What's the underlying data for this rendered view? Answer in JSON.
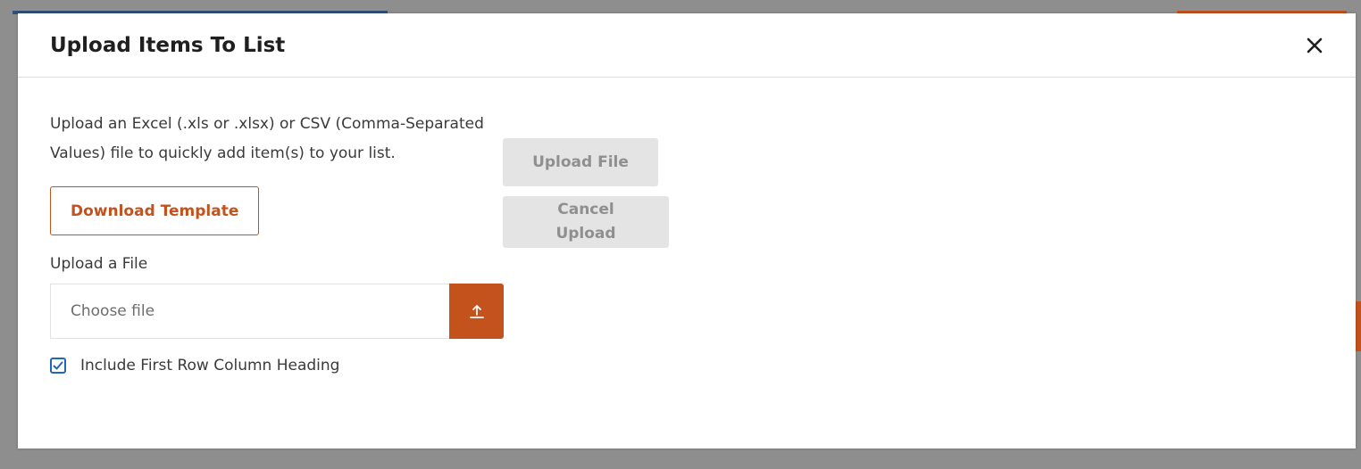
{
  "modal": {
    "title": "Upload Items To List",
    "close_icon": "close-icon",
    "description": "Upload an Excel (.xls or .xlsx) or CSV (Comma-Separated Values) file to quickly add item(s) to your list.",
    "download_template_label": "Download Template",
    "upload_file_label": "Upload a File",
    "file_input_placeholder": "Choose file",
    "file_upload_icon": "upload-icon",
    "checkbox_label": "Include First Row Column Heading",
    "checkbox_checked": true,
    "upload_file_button_label": "Upload File",
    "cancel_upload_button_label": "Cancel Upload"
  },
  "colors": {
    "accent": "#c4521d",
    "checkbox": "#2366b7",
    "disabled_button_bg": "#e4e4e4",
    "disabled_button_text": "#8f8f8f"
  }
}
